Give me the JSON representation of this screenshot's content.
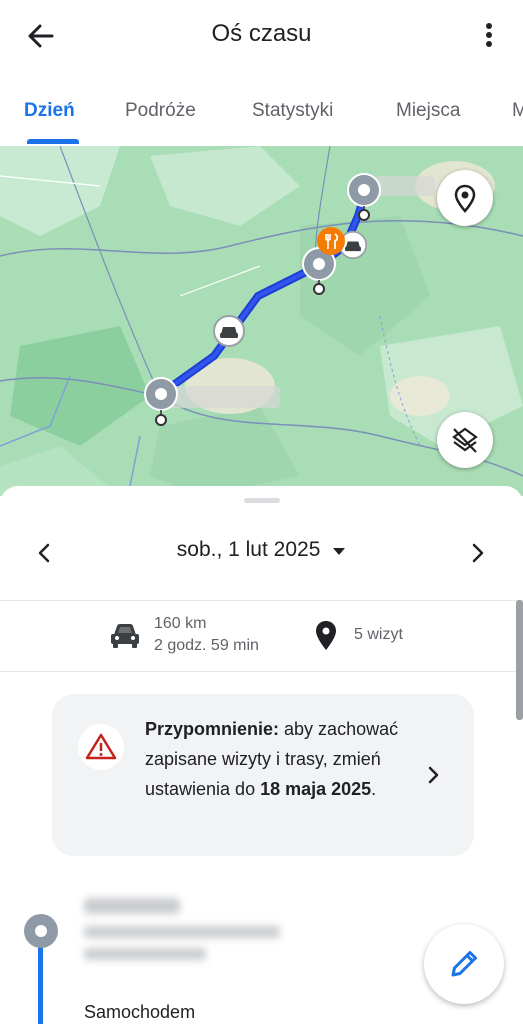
{
  "header": {
    "title": "Oś czasu"
  },
  "tabs": [
    {
      "label": "Dzień",
      "active": true
    },
    {
      "label": "Podróże"
    },
    {
      "label": "Statystyki"
    },
    {
      "label": "Miejsca"
    },
    {
      "label": "M"
    }
  ],
  "date": {
    "label": "sob., 1 lut 2025"
  },
  "summary": {
    "distance": "160 km",
    "duration": "2 godz. 59 min",
    "visits": "5 wizyt"
  },
  "reminder": {
    "bold_prefix": "Przypomnienie:",
    "text_1": " aby zachować zapisane wizyty i trasy, zmień ustawienia do ",
    "bold_date": "18 maja 2025",
    "text_2": "."
  },
  "timeline": {
    "travel_mode": "Samochodem"
  },
  "colors": {
    "accent": "#1a73e8",
    "route": "#1c3fd6",
    "restaurant": "#f57c00",
    "warning": "#c5221f"
  }
}
